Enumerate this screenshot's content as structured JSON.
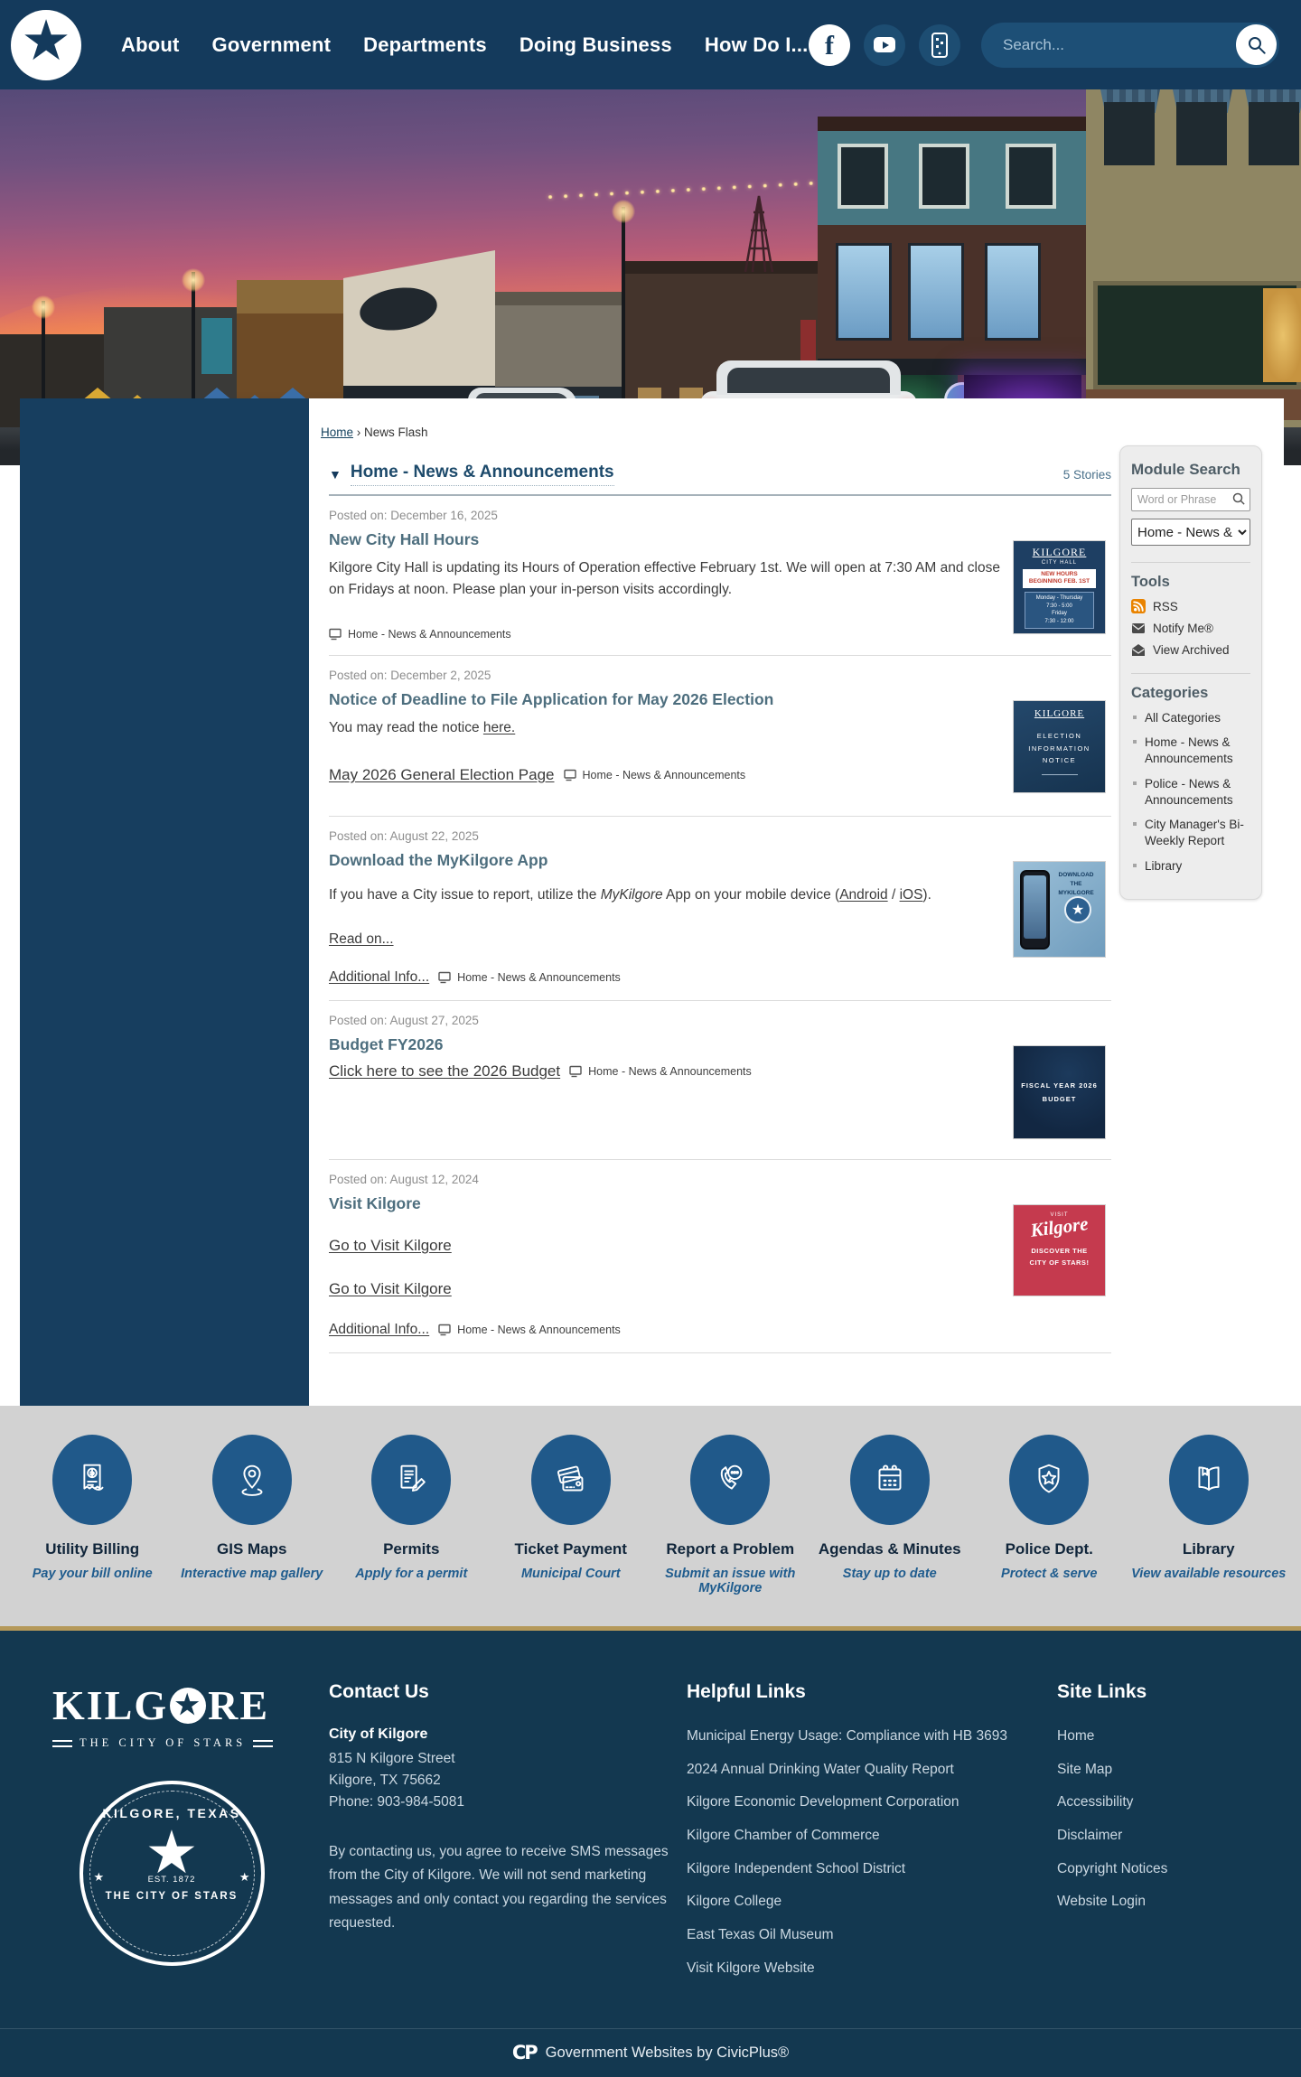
{
  "colors": {
    "header_navy": "#143a5c",
    "left_rail_navy": "#173e5f",
    "footer_navy": "#133850",
    "quicklink_circle_blue": "#20598a",
    "gold_divider": "#b5995a",
    "band_gray": "#d2d2d2",
    "module_panel_gray": "#ededed",
    "news_title_slate": "#4d6e7e",
    "section_title_navy": "#1d4a6b",
    "thumb_red": "#c53a4e",
    "rss_orange": "#e98300"
  },
  "header": {
    "nav": [
      {
        "label": "About"
      },
      {
        "label": "Government"
      },
      {
        "label": "Departments"
      },
      {
        "label": "Doing Business"
      },
      {
        "label": "How Do I..."
      }
    ],
    "search": {
      "placeholder": "Search..."
    }
  },
  "breadcrumb": {
    "home": "Home",
    "separator": "›",
    "current": "News Flash"
  },
  "news": {
    "collapse_arrow": "▼",
    "section_title": "Home - News & Announcements",
    "stories_count": "5 Stories",
    "items": [
      {
        "posted": "Posted on: December 16, 2025",
        "title": "New City Hall Hours",
        "body": "Kilgore City Hall is updating its Hours of Operation effective February 1st. We will open at 7:30 AM and close on Fridays at noon. Please plan your in-person visits accordingly.",
        "category": "Home - News & Announcements",
        "thumb": {
          "brand": "KILGORE",
          "brand_sub": "CITY HALL",
          "banner_line1": "NEW HOURS",
          "banner_line2": "BEGINNING FEB. 1ST",
          "hours_line1": "Monday - Thursday",
          "hours_line2": "7:30 - 5:00",
          "hours_line3": "Friday",
          "hours_line4": "7:30 - 12:00"
        }
      },
      {
        "posted": "Posted on: December 2, 2025",
        "title": "Notice of Deadline to File Application for May 2026 Election",
        "body_prefix": "You may read the notice ",
        "body_link": "here.",
        "page_link": "May 2026 General Election Page",
        "category": "Home - News & Announcements",
        "thumb": {
          "brand": "KILGORE",
          "line1": "ELECTION",
          "line2": "INFORMATION",
          "line3": "NOTICE"
        }
      },
      {
        "posted": "Posted on: August 22, 2025",
        "title": "Download the MyKilgore App",
        "body_part1": "If you have a City issue to report, utilize the ",
        "body_italic": "MyKilgore",
        "body_part2": " App on your mobile device (",
        "link_android": "Android",
        "body_sep": " / ",
        "link_ios": "iOS",
        "body_part3": ").",
        "read_on": "Read on...",
        "additional_info": "Additional Info...",
        "category": "Home - News & Announcements",
        "thumb": {
          "line1": "DOWNLOAD THE",
          "line2": "MYKILGORE APP",
          "star": "★"
        }
      },
      {
        "posted": "Posted on: August 27, 2025",
        "title": "Budget FY2026",
        "page_link": "Click here to see the 2026 Budget",
        "category": "Home - News & Announcements",
        "thumb": {
          "line1": "FISCAL YEAR 2026",
          "line2": "BUDGET"
        }
      },
      {
        "posted": "Posted on: August 12, 2024",
        "title": "Visit Kilgore",
        "link1": "Go to Visit Kilgore",
        "link2": "Go to Visit Kilgore",
        "additional_info": "Additional Info...",
        "category": "Home - News & Announcements",
        "thumb": {
          "visit": "VISIT",
          "script": "Kilgore",
          "line1": "DISCOVER THE",
          "line2": "CITY OF STARS!"
        }
      }
    ]
  },
  "module_search": {
    "title": "Module Search",
    "placeholder": "Word or Phrase",
    "category_value": "Home - News &",
    "tools_title": "Tools",
    "tools": [
      {
        "label": "RSS"
      },
      {
        "label": "Notify Me®"
      },
      {
        "label": "View Archived"
      }
    ],
    "categories_title": "Categories",
    "categories": [
      {
        "label": "All Categories"
      },
      {
        "label": "Home - News & Announcements"
      },
      {
        "label": "Police - News & Announcements"
      },
      {
        "label": "City Manager's Bi-Weekly Report"
      },
      {
        "label": "Library"
      }
    ]
  },
  "quicklinks": [
    {
      "label": "Utility Billing",
      "subtitle": "Pay your bill online"
    },
    {
      "label": "GIS Maps",
      "subtitle": "Interactive map gallery"
    },
    {
      "label": "Permits",
      "subtitle": "Apply for a permit"
    },
    {
      "label": "Ticket Payment",
      "subtitle": "Municipal Court"
    },
    {
      "label": "Report a Problem",
      "subtitle": "Submit an issue with MyKilgore"
    },
    {
      "label": "Agendas & Minutes",
      "subtitle": "Stay up to date"
    },
    {
      "label": "Police Dept.",
      "subtitle": "Protect & serve"
    },
    {
      "label": "Library",
      "subtitle": "View available resources"
    }
  ],
  "footer": {
    "wordmark": {
      "pre": "KILG",
      "star": "★",
      "post": "RE",
      "tagline": "THE CITY OF STARS"
    },
    "seal": {
      "top": "KILGORE, TEXAS",
      "star": "★",
      "est": "EST. 1872",
      "bottom": "THE CITY OF STARS",
      "side_star": "★"
    },
    "contact": {
      "title": "Contact Us",
      "org": "City of Kilgore",
      "address1": "815 N Kilgore Street",
      "address2": "Kilgore, TX 75662",
      "phone": "Phone: 903-984-5081",
      "sms_note": "By contacting us, you agree to receive SMS messages from the City of Kilgore. We will not send marketing messages and only contact you regarding the services requested."
    },
    "helpful": {
      "title": "Helpful Links",
      "links": [
        "Municipal Energy Usage: Compliance with HB 3693",
        "2024 Annual Drinking Water Quality Report",
        "Kilgore Economic Development Corporation",
        "Kilgore Chamber of Commerce",
        "Kilgore Independent School District",
        "Kilgore College",
        "East Texas Oil Museum",
        "Visit Kilgore Website"
      ]
    },
    "site": {
      "title": "Site Links",
      "links": [
        "Home",
        "Site Map",
        "Accessibility",
        "Disclaimer",
        "Copyright Notices",
        "Website Login"
      ]
    }
  },
  "bottom_bar": {
    "logo": "CP",
    "text": "Government Websites by CivicPlus®"
  }
}
